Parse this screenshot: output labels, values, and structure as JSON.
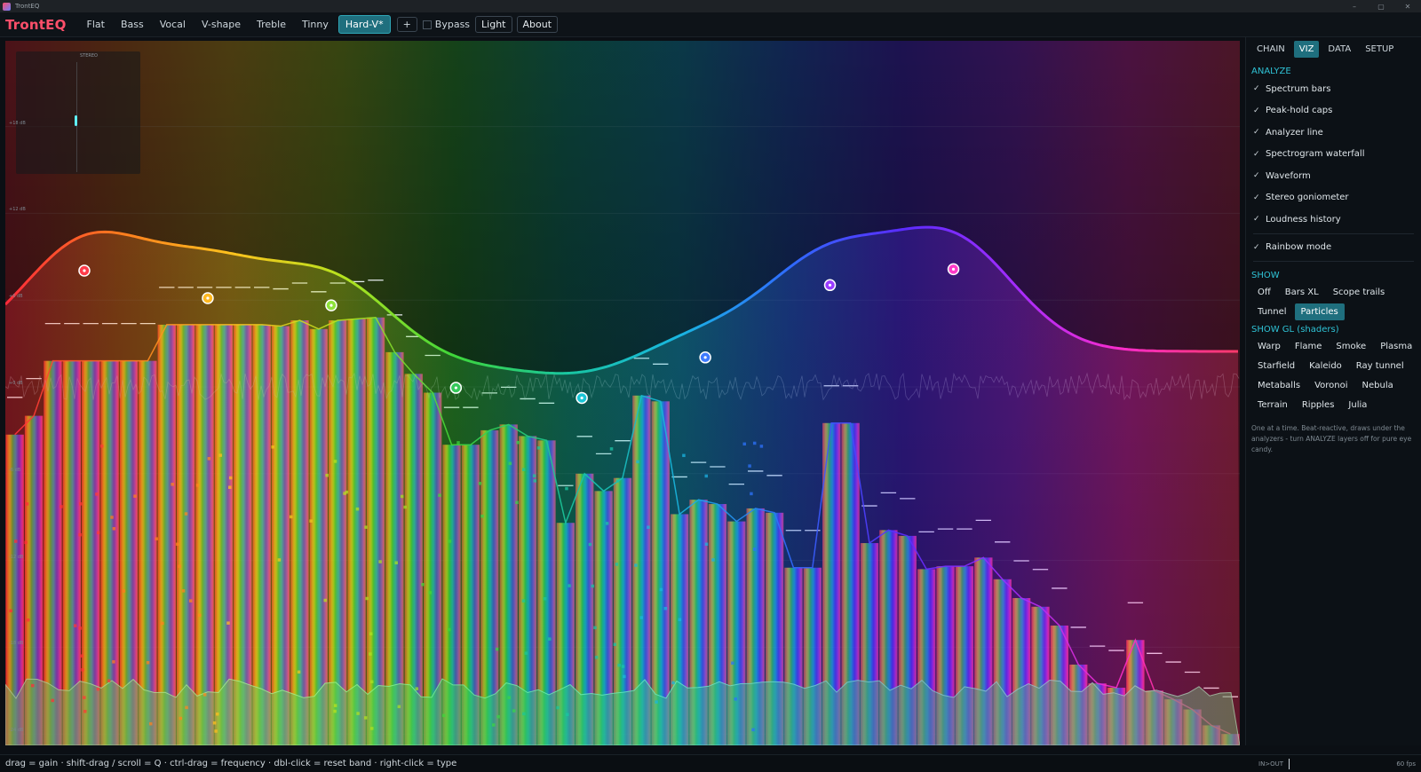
{
  "window": {
    "title": "TrontEQ",
    "controls": [
      "–",
      "▢",
      "✕"
    ]
  },
  "toolbar": {
    "logo": "TrontEQ",
    "presets": [
      "Flat",
      "Bass",
      "Vocal",
      "V-shape",
      "Treble",
      "Tinny",
      "Hard-V*"
    ],
    "active_preset": "Hard-V*",
    "add_label": "+",
    "bypass_label": "Bypass",
    "bypass_checked": false,
    "theme_label": "Light",
    "about_label": "About"
  },
  "visualizer": {
    "goniometer_label": "STEREO",
    "db_labels": [
      "+18 dB",
      "+12 dB",
      "+6 dB",
      "+0 dB",
      "-6 dB",
      "-12 dB",
      "-18 dB",
      "-24 dB"
    ],
    "db_values": [
      18,
      12,
      6,
      0,
      -6,
      -12,
      -18,
      -24
    ],
    "eq_bands": [
      {
        "x": 0.064,
        "gain_db": 7.3,
        "color": "#ff3b4a"
      },
      {
        "x": 0.164,
        "gain_db": 5.4,
        "color": "#ffb820"
      },
      {
        "x": 0.264,
        "gain_db": 4.9,
        "color": "#8ee23a"
      },
      {
        "x": 0.365,
        "gain_db": -0.8,
        "color": "#35c95a"
      },
      {
        "x": 0.467,
        "gain_db": -1.5,
        "color": "#19c6d6"
      },
      {
        "x": 0.567,
        "gain_db": 1.3,
        "color": "#3e7bff"
      },
      {
        "x": 0.668,
        "gain_db": 6.3,
        "color": "#9a3cff"
      },
      {
        "x": 0.768,
        "gain_db": 7.4,
        "color": "#ff3bc9"
      }
    ],
    "spectrum_db": [
      -3.3,
      -2,
      1.8,
      1.8,
      1.8,
      1.8,
      1.8,
      1.8,
      4.3,
      4.3,
      4.3,
      4.3,
      4.3,
      4.3,
      4.2,
      4.6,
      4.0,
      4.6,
      4.7,
      4.8,
      2.4,
      0.9,
      -0.4,
      -4,
      -4,
      -3,
      -2.6,
      -3.4,
      -3.7,
      -9.4,
      -6,
      -7.2,
      -6.3,
      -0.6,
      -1.0,
      -8.8,
      -7.8,
      -8.1,
      -9.3,
      -8.4,
      -8.7,
      -12.5,
      -12.5,
      -2.5,
      -2.5,
      -10.8,
      -9.9,
      -10.3,
      -12.6,
      -12.4,
      -12.4,
      -11.8,
      -13.3,
      -14.6,
      -15.2,
      -16.5,
      -19.2,
      -20.5,
      -20.8,
      -17.5,
      -21.0,
      -21.6,
      -22.3,
      -23.4,
      -24
    ]
  },
  "panel": {
    "tabs": [
      "CHAIN",
      "VIZ",
      "DATA",
      "SETUP"
    ],
    "active_tab": "VIZ",
    "analyze_title": "ANALYZE",
    "analyze_items": [
      "Spectrum bars",
      "Peak-hold caps",
      "Analyzer line",
      "Spectrogram waterfall",
      "Waveform",
      "Stereo goniometer",
      "Loudness history"
    ],
    "rainbow_label": "Rainbow mode",
    "check_mark": "✓",
    "show_title": "SHOW",
    "show_options": [
      "Off",
      "Bars XL",
      "Scope trails",
      "Tunnel",
      "Particles"
    ],
    "show_active": "Particles",
    "gl_title": "SHOW GL (shaders)",
    "gl_options": [
      "Warp",
      "Flame",
      "Smoke",
      "Plasma",
      "Starfield",
      "Kaleido",
      "Ray tunnel",
      "Metaballs",
      "Voronoi",
      "Nebula",
      "Terrain",
      "Ripples",
      "Julia"
    ],
    "note": "One at a time. Beat-reactive, draws under the analyzers - turn ANALYZE layers off for pure eye candy."
  },
  "status": {
    "hint": "drag = gain  ·  shift-drag / scroll = Q  ·  ctrl-drag = frequency  ·  dbl-click = reset band  ·  right-click = type",
    "inout": "IN>OUT",
    "fps": "60 fps"
  }
}
